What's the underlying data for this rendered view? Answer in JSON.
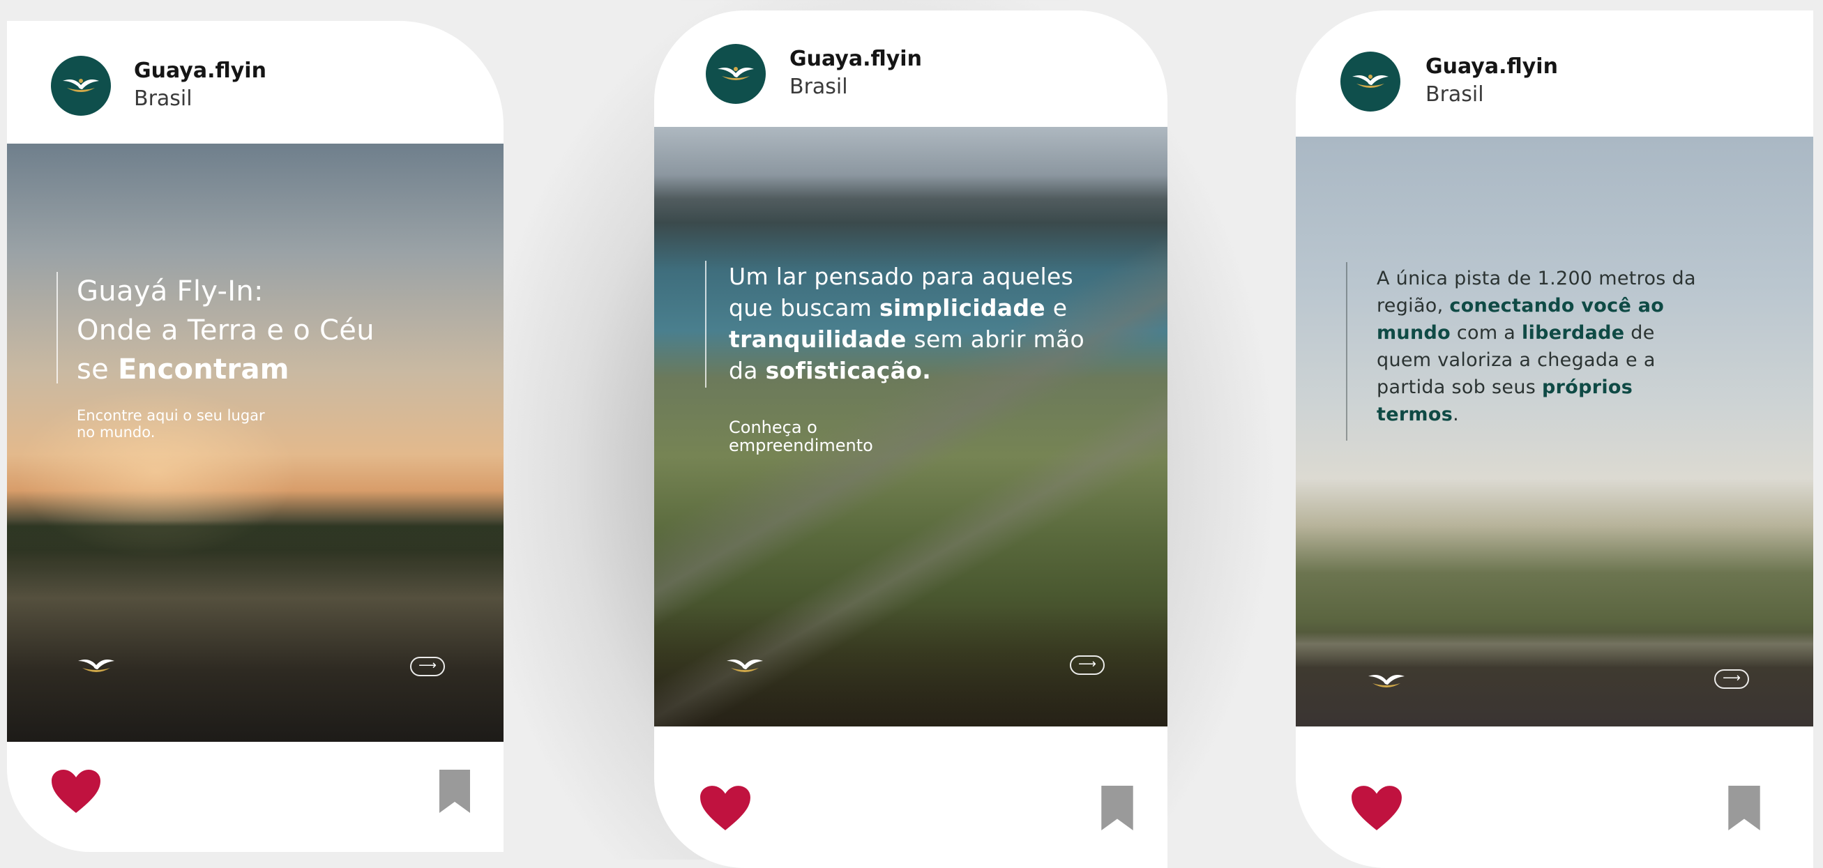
{
  "posts": [
    {
      "username": "Guaya.flyin",
      "location": "Brasil",
      "headline_1": "Guayá Fly-In:",
      "headline_2": "Onde a Terra e o Céu",
      "headline_3a": "se ",
      "headline_3b": "Encontram",
      "subtext_1": "Encontre aqui o seu lugar",
      "subtext_2": "no mundo."
    },
    {
      "username": "Guaya.flyin",
      "location": "Brasil",
      "h1": "Um lar pensado para aqueles",
      "h2a": "que buscam ",
      "h2b": "simplicidade",
      "h2c": " e",
      "h3a": "tranquilidade",
      "h3b": " sem abrir mão",
      "h4a": "da ",
      "h4b": "sofisticação.",
      "subtext_1": "Conheça o",
      "subtext_2": "empreendimento"
    },
    {
      "username": "Guaya.flyin",
      "location": "Brasil",
      "l1": "A única pista de 1.200 metros da",
      "l2a": "região, ",
      "l2b": "conectando você ao",
      "l3a": "mundo",
      "l3b": " com a ",
      "l3c": "liberdade",
      "l3d": " de",
      "l4": "quem valoriza a chegada e a",
      "l5a": "partida sob seus ",
      "l5b": "próprios",
      "l6a": "termos",
      "l6b": "."
    }
  ],
  "icons": {
    "heart": "heart-icon",
    "bookmark": "bookmark-icon",
    "arrow": "arrow-right-icon",
    "logo": "guaya-logo-icon"
  },
  "colors": {
    "avatar_bg": "#0f4f4c",
    "heart": "#c0123f",
    "bookmark": "#9a9a9a",
    "post3_accent": "#0f4a45"
  }
}
